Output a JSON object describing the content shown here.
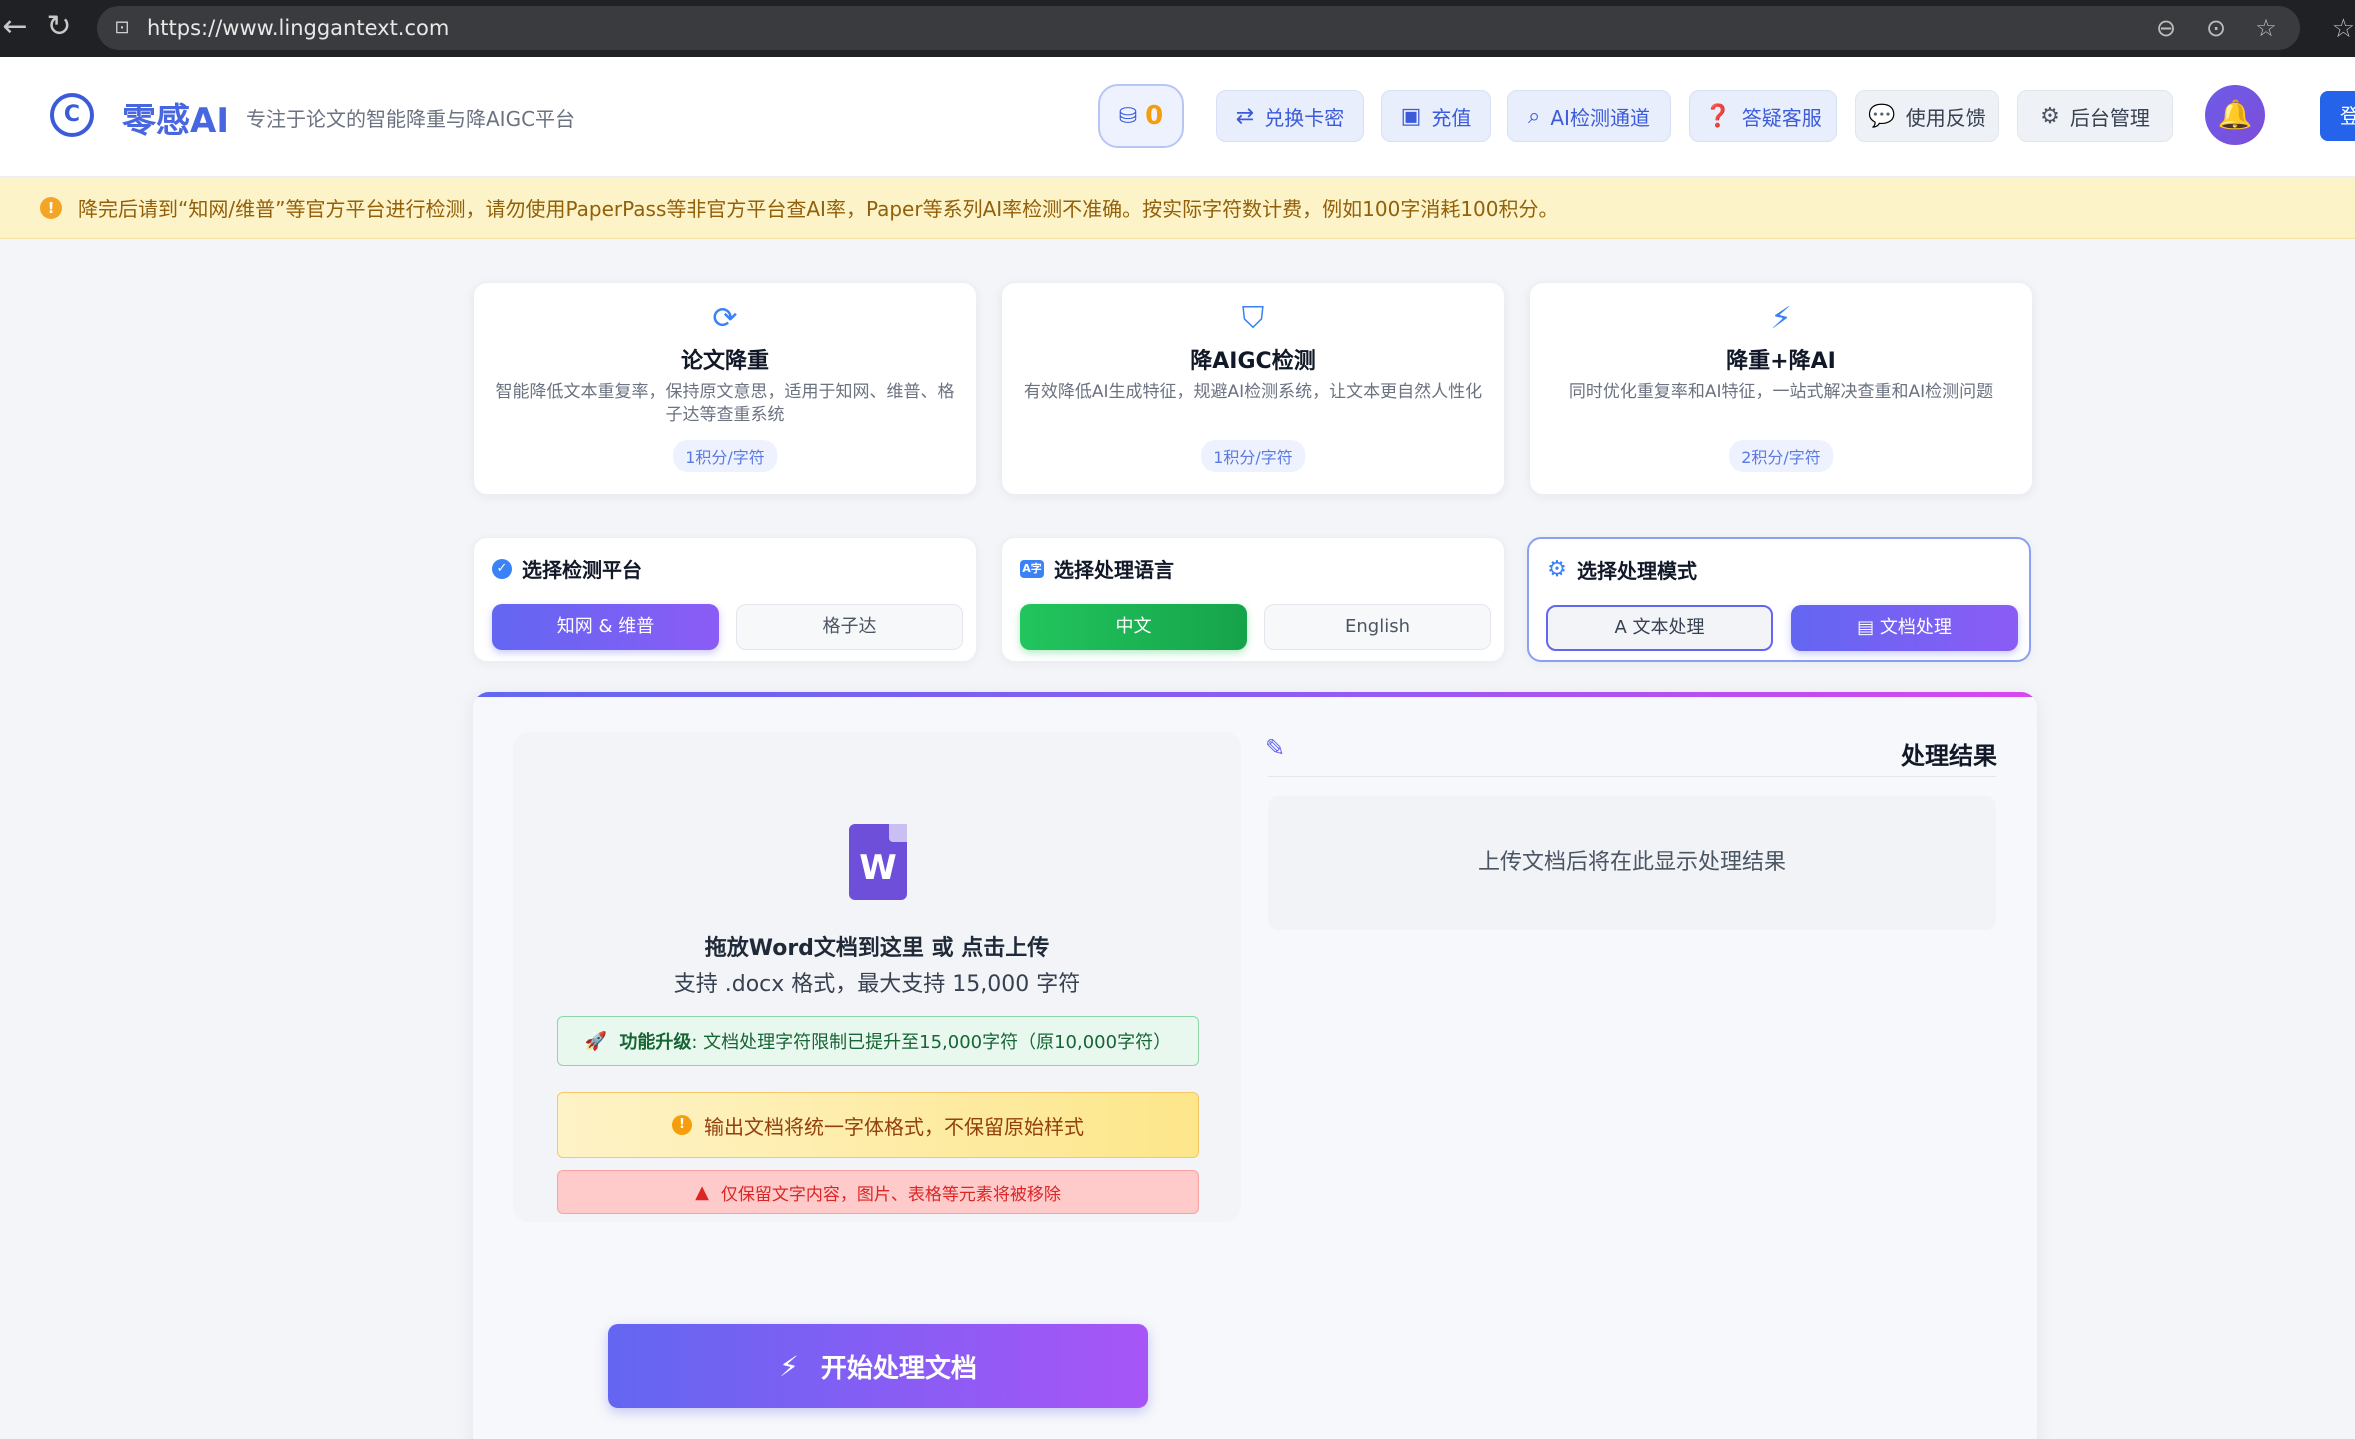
{
  "browser": {
    "url": "https://www.linggantext.com"
  },
  "header": {
    "brand": "零感AI",
    "tagline": "专注于论文的智能降重与降AIGC平台",
    "credits": "0",
    "buttons": {
      "exchange": "兑换卡密",
      "recharge": "充值",
      "detect": "AI检测通道",
      "support": "答疑客服",
      "feedback": "使用反馈",
      "admin": "后台管理"
    },
    "login": "登"
  },
  "notice": {
    "text": "降完后请到“知网/维普”等官方平台进行检测，请勿使用PaperPass等非官方平台查AI率，Paper等系列AI率检测不准确。按实际字符数计费，例如100字消耗100积分。"
  },
  "features": [
    {
      "title": "论文降重",
      "desc": "智能降低文本重复率，保持原文意思，适用于知网、维普、格子达等查重系统",
      "price": "1积分/字符"
    },
    {
      "title": "降AIGC检测",
      "desc": "有效降低AI生成特征，规避AI检测系统，让文本更自然人性化",
      "price": "1积分/字符"
    },
    {
      "title": "降重+降AI",
      "desc": "同时优化重复率和AI特征，一站式解决查重和AI检测问题",
      "price": "2积分/字符"
    }
  ],
  "options": {
    "platform": {
      "title": "选择检测平台",
      "opt1": "知网 & 维普",
      "opt2": "格子达"
    },
    "language": {
      "title": "选择处理语言",
      "opt1": "中文",
      "opt2": "English"
    },
    "mode": {
      "title": "选择处理模式",
      "opt1": "文本处理",
      "opt2": "文档处理"
    }
  },
  "upload": {
    "title": "拖放Word文档到这里 或 点击上传",
    "subtitle": "支持 .docx 格式，最大支持 15,000 字符",
    "upgrade_label": "功能升级",
    "upgrade_text": ": 文档处理字符限制已提升至15,000字符（原10,000字符）",
    "info": "输出文档将统一字体格式，不保留原始样式",
    "warning": "仅保留文字内容，图片、表格等元素将被移除"
  },
  "result": {
    "title": "处理结果",
    "placeholder": "上传文档后将在此显示处理结果"
  },
  "start_button": "开始处理文档"
}
